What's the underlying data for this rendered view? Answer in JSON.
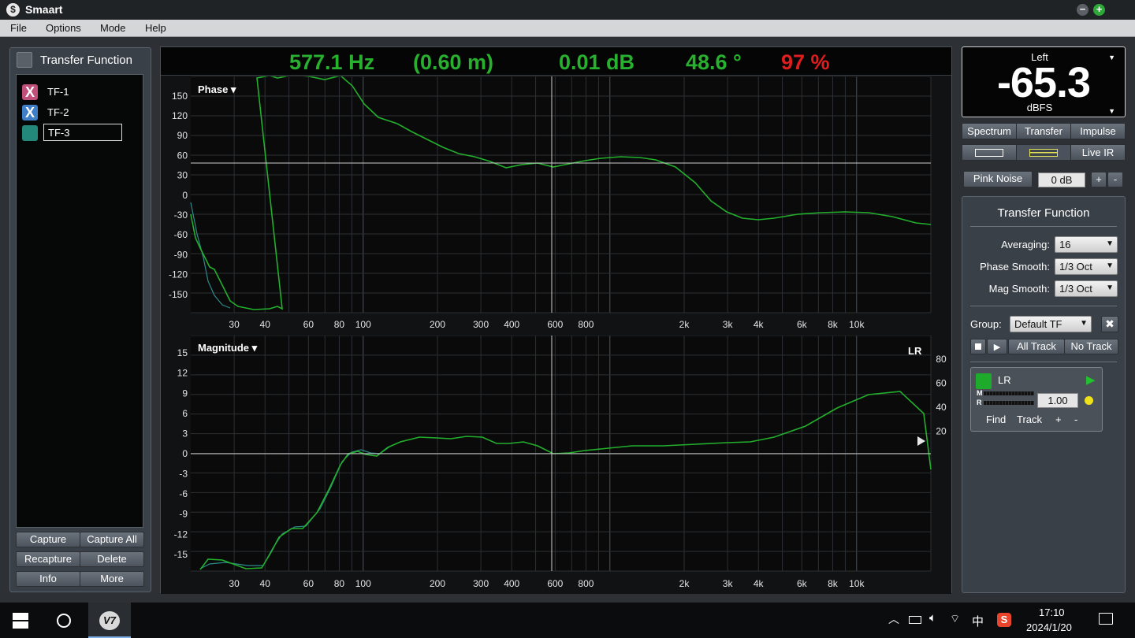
{
  "app": {
    "title": "Smaart",
    "logo_glyph": "$"
  },
  "menu": [
    "File",
    "Options",
    "Mode",
    "Help"
  ],
  "tf_panel": {
    "title": "Transfer Function",
    "items": [
      {
        "label": "TF-1",
        "glyph": "X",
        "color": "#c0507a"
      },
      {
        "label": "TF-2",
        "glyph": "X",
        "color": "#3f7fc8"
      },
      {
        "label": "TF-3",
        "glyph": "",
        "color": "#23887a"
      }
    ],
    "buttons": [
      "Capture",
      "Capture All",
      "Recapture",
      "Delete",
      "Info",
      "More"
    ]
  },
  "readout": {
    "frequency": "577.1 Hz",
    "distance": "(0.60 m)",
    "magnitude": "0.01 dB",
    "phase": "48.6 °",
    "coherence": "97 %",
    "colors": {
      "green": "#27b12e",
      "red": "#e11d1d"
    }
  },
  "phase_plot": {
    "label": "Phase ▾",
    "y_ticks": [
      "150",
      "120",
      "90",
      "60",
      "30",
      "0",
      "-30",
      "-60",
      "-90",
      "-120",
      "-150"
    ],
    "x_ticks": [
      "30",
      "40",
      "60",
      "80",
      "100",
      "200",
      "300",
      "400",
      "600",
      "800",
      "2k",
      "3k",
      "4k",
      "6k",
      "8k",
      "10k"
    ]
  },
  "mag_plot": {
    "label": "Magnitude ▾",
    "trace_label": "LR",
    "y_ticks": [
      "15",
      "12",
      "9",
      "6",
      "3",
      "0",
      "-3",
      "-6",
      "-9",
      "-12",
      "-15"
    ],
    "coh_ticks": [
      "80",
      "60",
      "40",
      "20"
    ],
    "x_ticks": [
      "30",
      "40",
      "60",
      "80",
      "100",
      "200",
      "300",
      "400",
      "600",
      "800",
      "2k",
      "3k",
      "4k",
      "6k",
      "8k",
      "10k"
    ]
  },
  "meter": {
    "channel": "Left",
    "value": "-65.3",
    "unit": "dBFS"
  },
  "mode_tabs": [
    "Spectrum",
    "Transfer",
    "Impulse"
  ],
  "view_tabs": {
    "live": "Live IR"
  },
  "generator": {
    "label": "Pink Noise",
    "level": "0 dB",
    "plus": "+",
    "minus": "-"
  },
  "tf_settings": {
    "title": "Transfer Function",
    "averaging_label": "Averaging:",
    "averaging": "16",
    "phase_smooth_label": "Phase Smooth:",
    "phase_smooth": "1/3 Oct",
    "mag_smooth_label": "Mag Smooth:",
    "mag_smooth": "1/3 Oct",
    "group_label": "Group:",
    "group": "Default TF",
    "all_track": "All Track",
    "no_track": "No Track"
  },
  "measurement": {
    "name": "LR",
    "meter_m": "M",
    "meter_r": "R",
    "gain": "1.00",
    "find": "Find",
    "track": "Track",
    "plus": "+",
    "minus": "-"
  },
  "taskbar": {
    "app_glyph": "V7",
    "ime": "中",
    "time": "17:10",
    "date": "2024/1/20"
  }
}
